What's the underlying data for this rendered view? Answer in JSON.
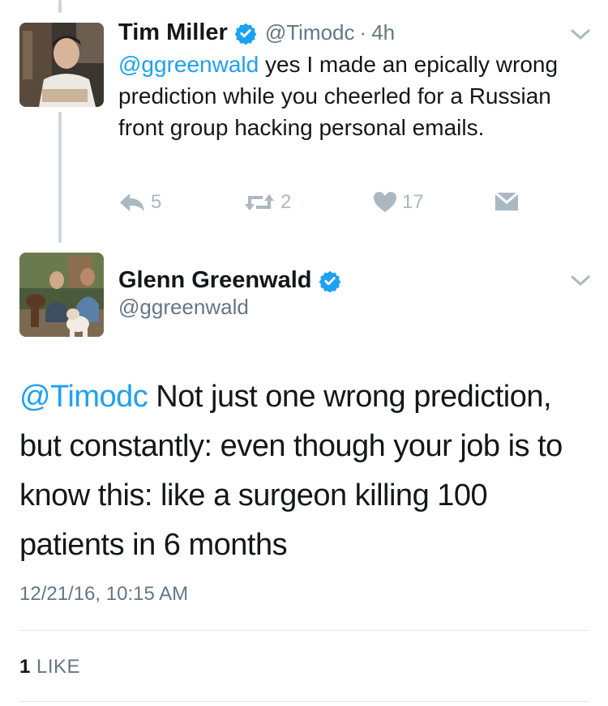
{
  "reply_tweet": {
    "author": {
      "display_name": "Tim Miller",
      "handle": "@Timodc",
      "time": "4h",
      "verified": true
    },
    "text_mention": "@ggreenwald",
    "text_body": " yes I made an epically wrong prediction while you cheerled for a Russian front group hacking personal emails.",
    "actions": {
      "reply_count": "5",
      "retweet_count": "2",
      "like_count": "17"
    }
  },
  "main_tweet": {
    "author": {
      "display_name": "Glenn Greenwald",
      "handle": "@ggreenwald",
      "verified": true
    },
    "text_mention": "@Timodc",
    "text_body": " Not just one wrong prediction, but constantly: even though your job is to know this: like a surgeon killing 100 patients in 6 months",
    "timestamp": "12/21/16, 10:15 AM",
    "likes_count": "1",
    "likes_label": "LIKE"
  },
  "colors": {
    "link_blue": "#1da1f2",
    "verified_blue": "#1da1f2",
    "secondary_gray": "#657786",
    "action_gray": "#aab8c2"
  },
  "icons": [
    "reply-icon",
    "retweet-icon",
    "heart-icon",
    "dm-envelope-icon",
    "verified-badge-icon",
    "chevron-down-icon"
  ]
}
